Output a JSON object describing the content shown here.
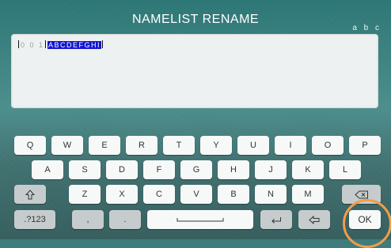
{
  "header": {
    "title": "NAMELIST RENAME",
    "mode": "a b c"
  },
  "editor": {
    "prefix": "0 0 1",
    "selected_text": "ABCDEFGHI"
  },
  "keyboard": {
    "row1": [
      "Q",
      "W",
      "E",
      "R",
      "T",
      "Y",
      "U",
      "I",
      "O",
      "P"
    ],
    "row2": [
      "A",
      "S",
      "D",
      "F",
      "G",
      "H",
      "J",
      "K",
      "L"
    ],
    "row3": [
      "Z",
      "X",
      "C",
      "V",
      "B",
      "N",
      "M"
    ],
    "row4": {
      "num": ".?123",
      "comma": ",",
      "period": ".",
      "ok": "OK"
    }
  },
  "colors": {
    "selection": "#1515d0",
    "highlight_ring": "#f39c4b"
  },
  "icons": [
    "shift-icon",
    "backspace-icon",
    "space-icon",
    "return-icon",
    "undo-icon"
  ]
}
